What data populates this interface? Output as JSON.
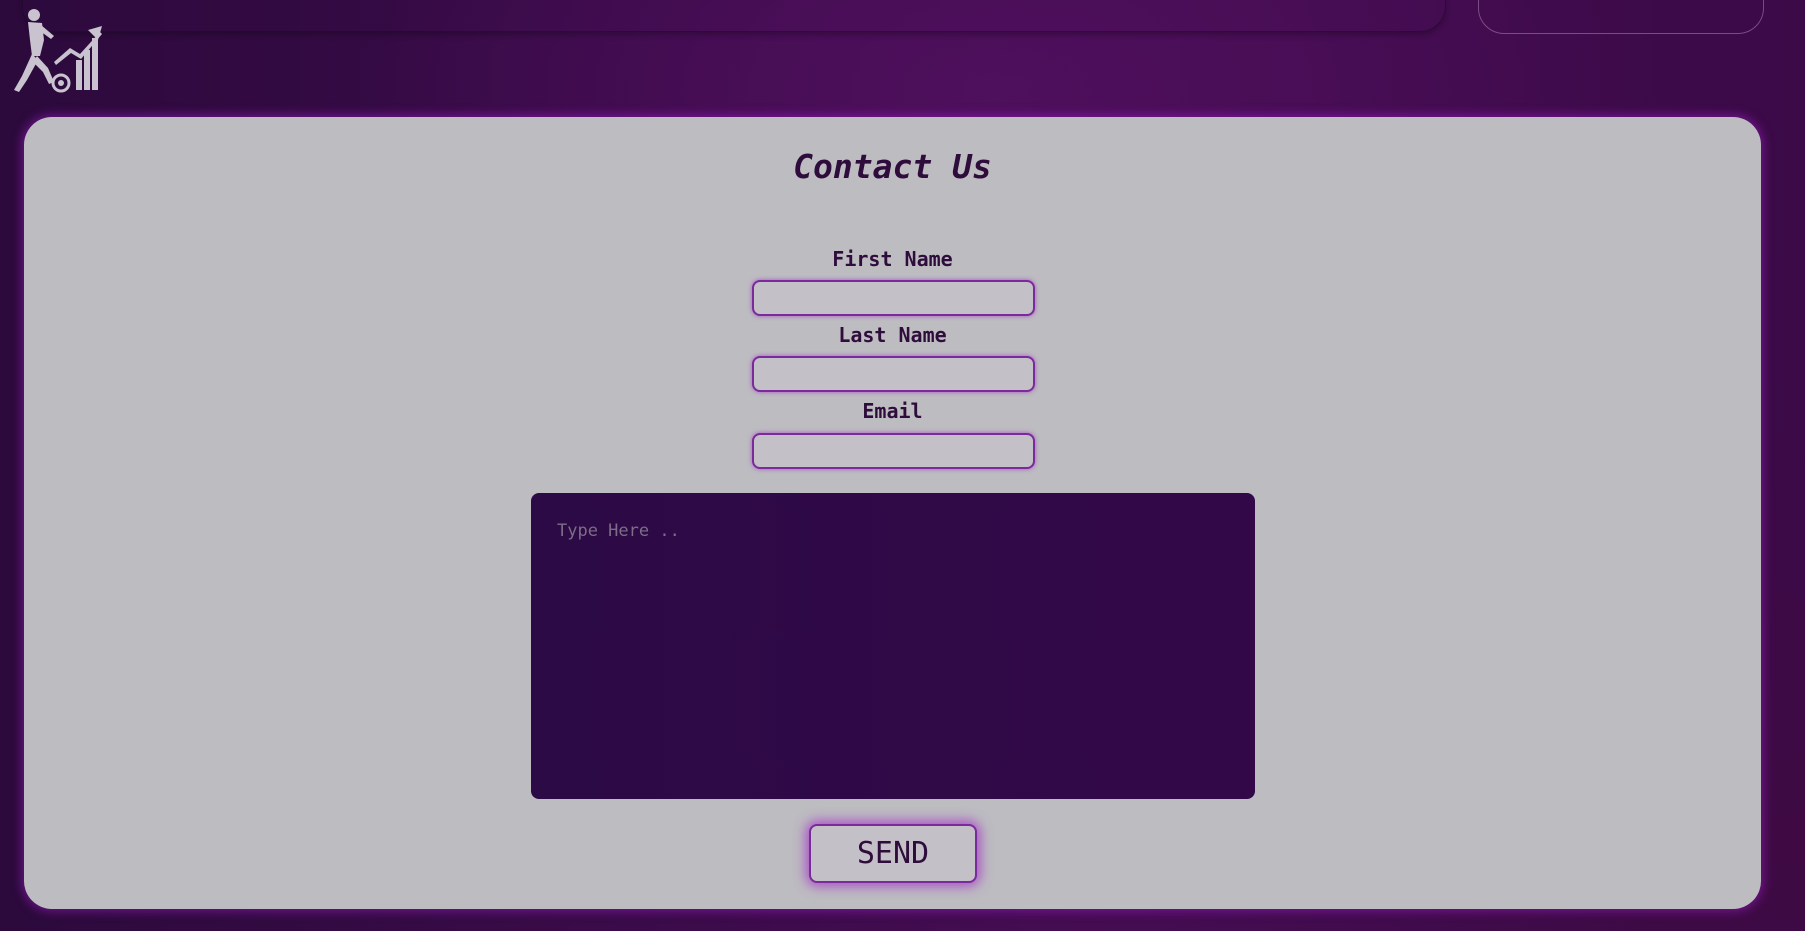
{
  "logo": {
    "icon": "soccer-player-growth-chart-icon",
    "color": "#c9c3cf"
  },
  "contact": {
    "title": "Contact Us",
    "first_name_label": "First Name",
    "first_name_value": "",
    "last_name_label": "Last Name",
    "last_name_value": "",
    "email_label": "Email",
    "email_value": "",
    "message_placeholder": "Type Here ..",
    "message_value": "",
    "send_label": "SEND"
  },
  "colors": {
    "background": "#3a0b49",
    "card": "#bdbcc1",
    "accent": "#7a2a9a",
    "text": "#2e0c3b",
    "message_box": "#2f0949"
  }
}
